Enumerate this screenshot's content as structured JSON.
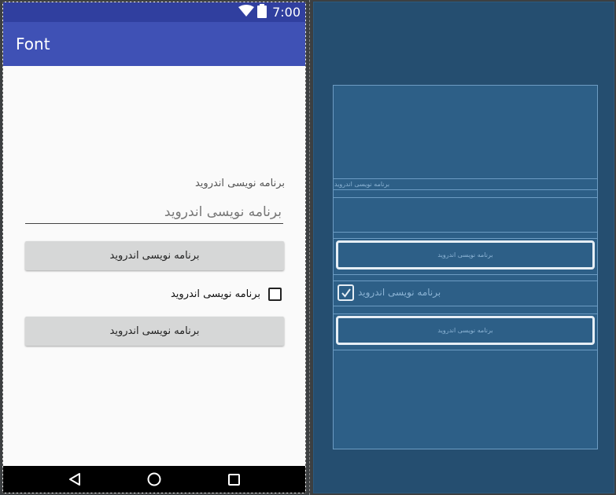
{
  "status_bar": {
    "time": "7:00",
    "icons": [
      "wifi-icon",
      "battery-icon"
    ]
  },
  "app_bar": {
    "title": "Font"
  },
  "content": {
    "label_text": "برنامه نویسی اندروید",
    "input_value": "برنامه نویسی اندروید",
    "button_1": "برنامه نویسی اندروید",
    "checkbox_label": "برنامه نویسی اندروید",
    "button_2": "برنامه نویسی اندروید"
  },
  "nav_bar": {
    "icons": [
      "back-icon",
      "home-icon",
      "recents-icon"
    ]
  },
  "blueprint": {
    "label_text": "برنامه نویسی اندروید",
    "button_1": "برنامه نویسی اندروید",
    "checkbox_label": "برنامه نویسی اندروید",
    "button_2": "برنامه نویسی اندروید"
  },
  "colors": {
    "status_bar": "#303f9f",
    "app_bar": "#3f51b5",
    "blueprint_bg": "#254e70",
    "blueprint_frame": "#2d5f87"
  }
}
